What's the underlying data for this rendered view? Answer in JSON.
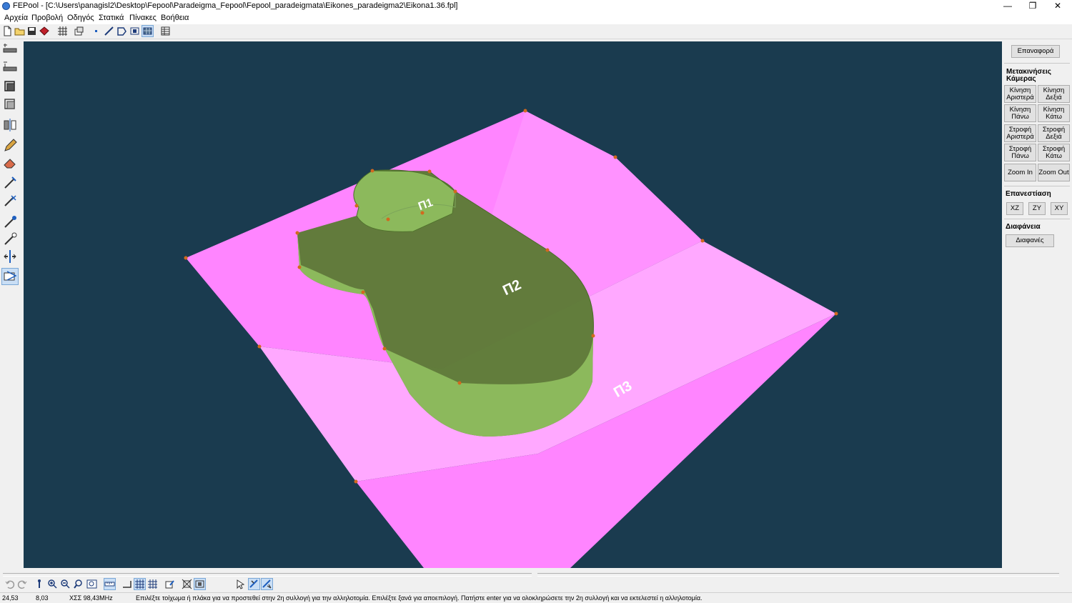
{
  "window": {
    "title": "FEPool - [C:\\Users\\panagisl2\\Desktop\\Fepool\\Paradeigma_Fepool\\Fepool_paradeigmata\\Eikones_paradeigma2\\Eikona1.36.fpl]",
    "minimize": "—",
    "restore": "❐",
    "close": "✕"
  },
  "menu": [
    "Αρχεία",
    "Προβολή",
    "Οδηγός",
    "Στατικά",
    "Πίνακες",
    "Βοήθεια"
  ],
  "viewport": {
    "colors": {
      "background": "#1a3b4f",
      "slab": "#ff85ff",
      "wall": "#8cb95c"
    },
    "labels": {
      "slab1": "Π1",
      "slab2": "Π2",
      "slab3": "Π3"
    }
  },
  "right_panel": {
    "reset": "Επαναφορά",
    "camera_heading": "Μετακινήσεις Κάμερας",
    "move_left": "Κίνηση Αριστερά",
    "move_right": "Κίνηση Δεξιά",
    "move_up": "Κίνηση Πάνω",
    "move_down": "Κίνηση Κάτω",
    "rotate_left": "Στροφή Αριστερά",
    "rotate_right": "Στροφή Δεξιά",
    "rotate_up": "Στροφή Πάνω",
    "rotate_down": "Στροφή Κάτω",
    "zoom_in": "Zoom In",
    "zoom_out": "Zoom Out",
    "plane_heading": "Επανεστίαση",
    "plane_xz": "XZ",
    "plane_zy": "ZY",
    "plane_xy": "XY",
    "transparency_heading": "Διαφάνεια",
    "transparent": "Διαφανές"
  },
  "status": {
    "x": "24,53",
    "y": "8,03",
    "clock": "ΧΣΣ 98,43MHz",
    "message": "Επιλέξτε τοίχωμα ή πλάκα για να προστεθεί στην 2η συλλογή για την αλληλοτομία. Επιλέξτε ξανά για αποεπιλογή. Πατήστε enter για να ολοκληρώσετε την 2η συλλογή και να εκτελεστεί η αλληλοτομία."
  }
}
